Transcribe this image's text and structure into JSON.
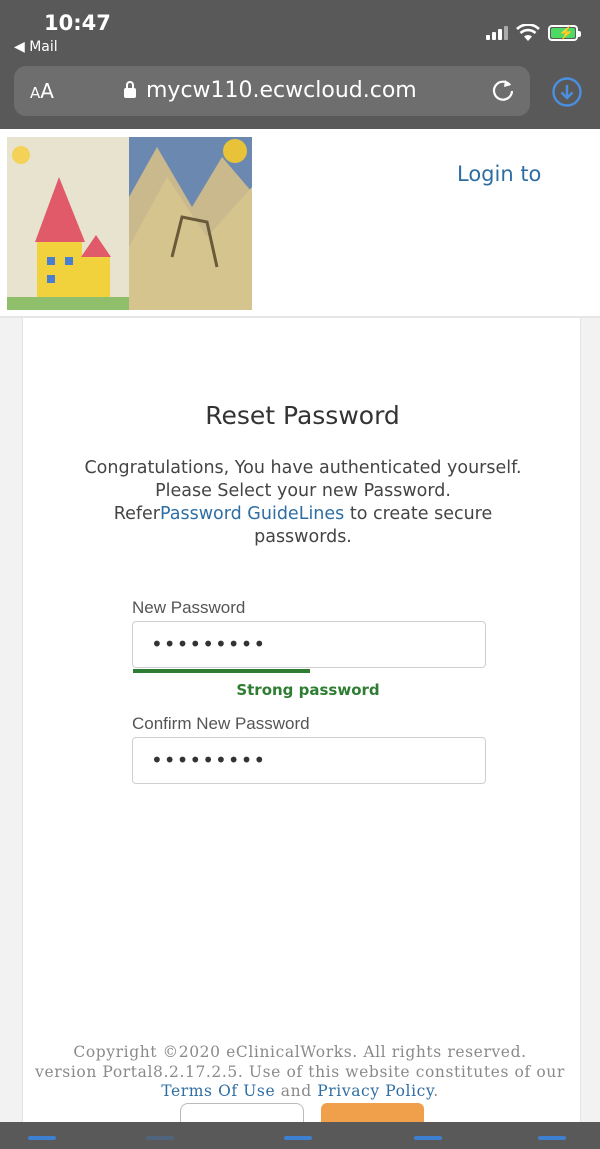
{
  "status_bar": {
    "time": "10:47",
    "back_app": "◀ Mail"
  },
  "browser": {
    "aa_label_big": "A",
    "aa_label_small": "A",
    "url": "mycw110.ecwcloud.com"
  },
  "header": {
    "login_link": "Login to"
  },
  "form": {
    "title": "Reset Password",
    "intro_line1": "Congratulations, You have authenticated yourself.",
    "intro_line2": "Please Select your new Password.",
    "intro_refer": "Refer",
    "intro_link": "Password GuideLines",
    "intro_tail": " to create secure passwords.",
    "new_password_label": "New Password",
    "new_password_value": "•••••••••",
    "strength_text": "Strong password",
    "strength_fraction": 0.5,
    "confirm_password_label": "Confirm New Password",
    "confirm_password_value": "•••••••••"
  },
  "footer": {
    "line1": "Copyright ©2020 eClinicalWorks. All rights reserved.",
    "line2": "version Portal8.2.17.2.5.  Use of this website constitutes of our",
    "terms_link": "Terms Of Use",
    "and_text": " and ",
    "privacy_link": "Privacy Policy",
    "period": "."
  },
  "colors": {
    "accent_link": "#2f6ea3",
    "strength_green": "#2e7d32",
    "next_button": "#f0a04b",
    "chrome_gray": "#595959"
  }
}
